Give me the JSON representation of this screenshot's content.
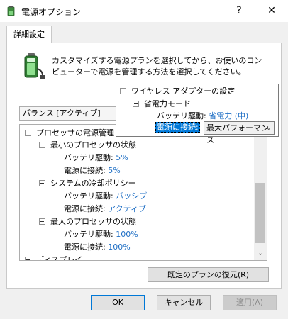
{
  "window": {
    "title": "電源オプション",
    "help_label": "?",
    "close_label": "✕"
  },
  "tab": {
    "label": "詳細設定"
  },
  "description": "カスタマイズする電源プランを選択してから、お使いのコンピューターで電源を管理する方法を選択してください。",
  "plan": {
    "selected": "バランス [アクティブ]"
  },
  "tree": {
    "processor": "プロセッサの電源管理",
    "min_state": "最小のプロセッサの状態",
    "min_battery_label": "バッテリ駆動:",
    "min_battery_value": "5%",
    "min_ac_label": "電源に接続:",
    "min_ac_value": "5%",
    "cooling": "システムの冷却ポリシー",
    "cool_battery_label": "バッテリ駆動:",
    "cool_battery_value": "パッシブ",
    "cool_ac_label": "電源に接続:",
    "cool_ac_value": "アクティブ",
    "max_state": "最大のプロセッサの状態",
    "max_battery_label": "バッテリ駆動:",
    "max_battery_value": "100%",
    "max_ac_label": "電源に接続:",
    "max_ac_value": "100%",
    "display": "ディスプレイ"
  },
  "popup": {
    "wireless": "ワイヤレス アダプターの設定",
    "power_mode": "省電力モード",
    "battery_label": "バッテリ駆動:",
    "battery_value": "省電力 (中)",
    "ac_label": "電源に接続:",
    "ac_value": "最大パフォーマンス"
  },
  "buttons": {
    "restore": "既定のプランの復元(R)",
    "ok": "OK",
    "cancel": "キャンセル",
    "apply": "適用(A)"
  }
}
